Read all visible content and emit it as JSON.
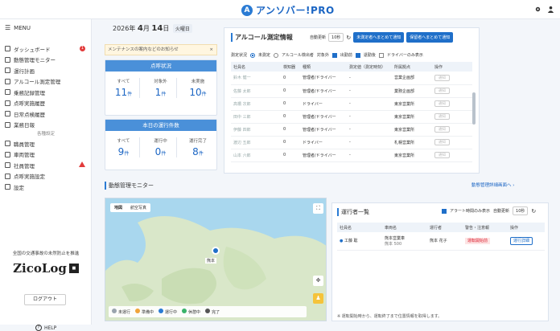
{
  "app": {
    "title": "アンソバー!PRO"
  },
  "sidebar": {
    "menu_label": "MENU",
    "items": [
      {
        "label": "ダッシュボード",
        "badge": "1"
      },
      {
        "label": "動態管理モニター"
      },
      {
        "label": "運行計画"
      },
      {
        "label": "アルコール測定管理"
      },
      {
        "label": "乗務記録管理"
      },
      {
        "label": "点呼実施履歴"
      },
      {
        "label": "日常点検履歴"
      },
      {
        "label": "業務日報"
      }
    ],
    "section_label": "各種設定",
    "items2": [
      {
        "label": "職員管理"
      },
      {
        "label": "車両管理"
      },
      {
        "label": "社員管理",
        "warn": true
      },
      {
        "label": "点呼実施設定"
      },
      {
        "label": "設定"
      }
    ],
    "partner_caption": "全国の交通事故の未然防止を推進",
    "partner_logo": "ZicoLog",
    "logout": "ログアウト",
    "help": "HELP"
  },
  "date": {
    "year": "2026年",
    "month": "4",
    "month_unit": "月",
    "day": "14",
    "day_unit": "日",
    "weekday": "火曜日"
  },
  "notice": {
    "text": "メンテナンスの案内などのお知らせ",
    "close": "×"
  },
  "inspection": {
    "title": "点呼状況",
    "stats": [
      {
        "label": "すべて",
        "value": "11",
        "unit": "件"
      },
      {
        "label": "対象外",
        "value": "1",
        "unit": "件"
      },
      {
        "label": "未実施",
        "value": "10",
        "unit": "件"
      }
    ]
  },
  "ops_today": {
    "title": "本日の運行件数",
    "stats": [
      {
        "label": "すべて",
        "value": "9",
        "unit": "件"
      },
      {
        "label": "運行中",
        "value": "0",
        "unit": "件"
      },
      {
        "label": "運行完了",
        "value": "8",
        "unit": "件"
      }
    ]
  },
  "alcohol": {
    "title": "アルコール測定情報",
    "refresh_label": "自動更新",
    "refresh_value": "10秒",
    "btn_send1": "未測定者へまとめて通知",
    "btn_send2": "保留者へまとめて通知",
    "filter_label": "測定状況",
    "filter_opts": [
      "未測定",
      "アルコール検出者",
      "対象外"
    ],
    "check_opts": [
      "出勤前",
      "退勤後",
      "ドライバーのみ表示"
    ],
    "columns": [
      "社員名",
      "検知器",
      "種類",
      "測定値（測定時刻）",
      "所属拠点",
      "操作"
    ],
    "rows": [
      {
        "name": "鈴木 健一",
        "count": "0",
        "type": "管理者/ドライバー",
        "value": "-",
        "base": "営業企画部",
        "op": "通知"
      },
      {
        "name": "佐藤 太郎",
        "count": "0",
        "type": "管理者/ドライバー",
        "value": "-",
        "base": "業務企画部",
        "op": "通知"
      },
      {
        "name": "高橋 次郎",
        "count": "0",
        "type": "ドライバー",
        "value": "-",
        "base": "東京営業所",
        "op": "通知"
      },
      {
        "name": "田中 三郎",
        "count": "0",
        "type": "管理者/ドライバー",
        "value": "-",
        "base": "東京営業所",
        "op": "通知"
      },
      {
        "name": "伊藤 四郎",
        "count": "0",
        "type": "管理者/ドライバー",
        "value": "-",
        "base": "東京営業所",
        "op": "通知"
      },
      {
        "name": "渡辺 五郎",
        "count": "0",
        "type": "ドライバー",
        "value": "-",
        "base": "札幌営業所",
        "op": "通知"
      },
      {
        "name": "山本 六郎",
        "count": "0",
        "type": "管理者/ドライバー",
        "value": "-",
        "base": "東京営業所",
        "op": "通知"
      }
    ]
  },
  "monitor": {
    "title": "動態管理モニター",
    "link": "動態管理詳細画面へ"
  },
  "map": {
    "tabs": [
      "地図",
      "航空写真"
    ],
    "pin_label": "熊本",
    "legend": [
      "未運行",
      "準備中",
      "運行中",
      "休憩中",
      "完了"
    ],
    "legend_colors": [
      "#9aa4ae",
      "#f0a43a",
      "#2a7bd4",
      "#39b36a",
      "#555555"
    ]
  },
  "ops_list": {
    "title": "運行者一覧",
    "alert_label": "アラート時間のみ表示",
    "refresh_label": "自動更新",
    "refresh_value": "10秒",
    "columns": [
      "社員名",
      "車両名",
      "運行者",
      "警告・注意報",
      "操作"
    ],
    "rows": [
      {
        "name": "工藤 聡",
        "vehicle": "熊本営業車",
        "vehicle_sub": "熊本 500",
        "driver": "熊本 花子",
        "status": "運転開始前",
        "op": "運行詳細"
      }
    ],
    "note": "※ 運転開始時から、運転終了まで位置情報を取得します。"
  }
}
